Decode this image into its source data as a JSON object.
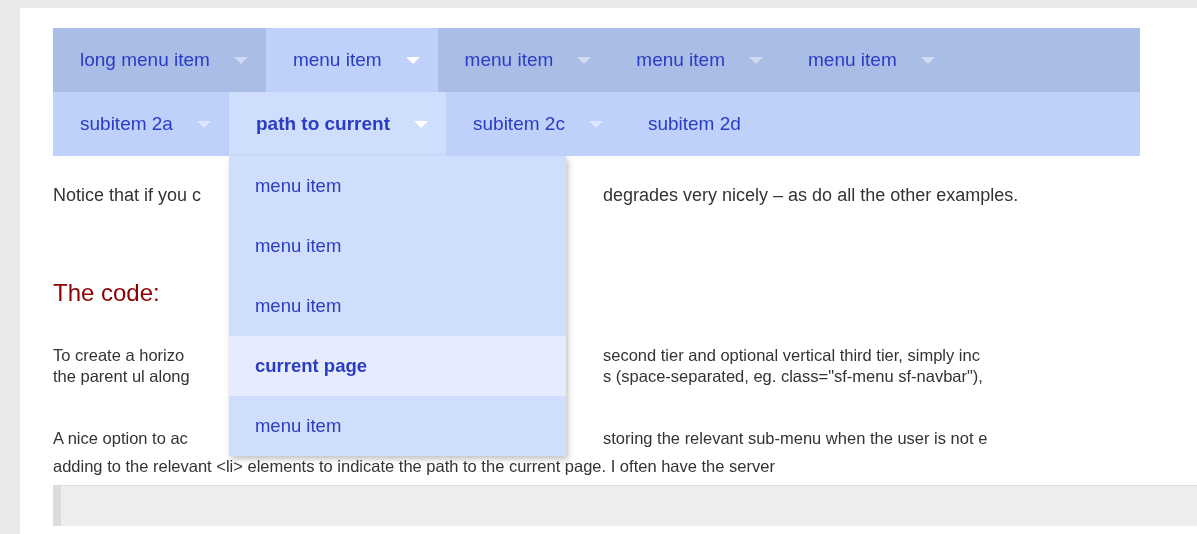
{
  "menu": [
    {
      "label": "long menu item",
      "selected": false,
      "has_submenu": true
    },
    {
      "label": "menu item",
      "selected": true,
      "has_submenu": true
    },
    {
      "label": "menu item",
      "selected": false,
      "has_submenu": true
    },
    {
      "label": "menu item",
      "selected": false,
      "has_submenu": true
    },
    {
      "label": "menu item",
      "selected": false,
      "has_submenu": true
    }
  ],
  "submenu": [
    {
      "label": "subitem 2a",
      "selected": false,
      "has_submenu": true
    },
    {
      "label": "path to current",
      "selected": true,
      "has_submenu": true,
      "dropdown": [
        {
          "label": "menu item",
          "selected": false
        },
        {
          "label": "menu item",
          "selected": false
        },
        {
          "label": "menu item",
          "selected": false
        },
        {
          "label": "current page",
          "selected": true
        },
        {
          "label": "menu item",
          "selected": false
        }
      ]
    },
    {
      "label": "subitem 2c",
      "selected": false,
      "has_submenu": true
    },
    {
      "label": "subitem 2d",
      "selected": false,
      "has_submenu": false
    }
  ],
  "notice": {
    "left": "Notice that if you c",
    "right": "degrades very nicely – as do all the other examples."
  },
  "heading": "The code:",
  "paragraphs": [
    {
      "lines": [
        {
          "kind": "split",
          "left": "To create a horizo",
          "right": "second tier and optional vertical third tier, simply inc"
        },
        {
          "kind": "split",
          "left": "the parent ul along",
          "right": "s (space-separated, eg. class=\"sf-menu sf-navbar\"),"
        }
      ]
    },
    {
      "lines": [
        {
          "kind": "split",
          "left": "A nice option to ac",
          "right": "storing the relevant sub-menu when the user is not e"
        },
        {
          "kind": "full",
          "text": "adding to the relevant <li> elements to indicate the path to the current page. I often have the server"
        }
      ]
    }
  ]
}
